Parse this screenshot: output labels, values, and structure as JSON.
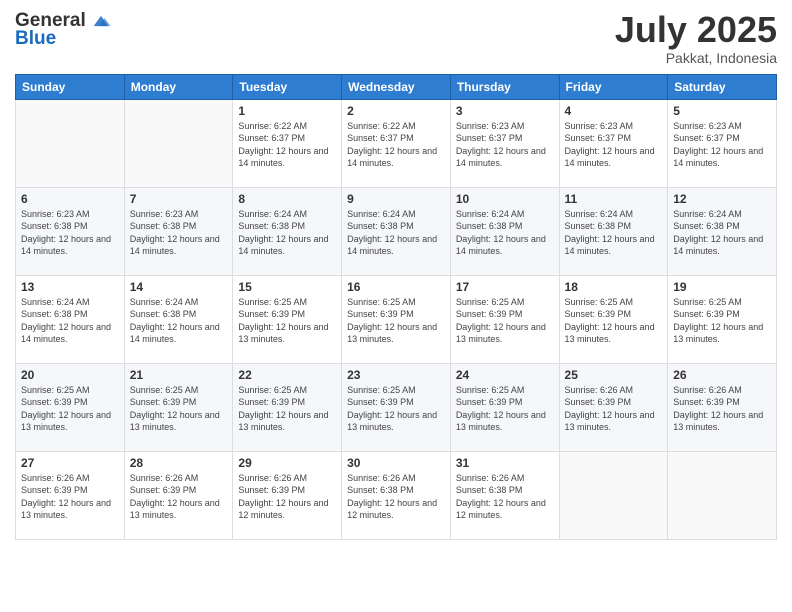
{
  "logo": {
    "text1": "General",
    "text2": "Blue"
  },
  "title": "July 2025",
  "location": "Pakkat, Indonesia",
  "weekdays": [
    "Sunday",
    "Monday",
    "Tuesday",
    "Wednesday",
    "Thursday",
    "Friday",
    "Saturday"
  ],
  "weeks": [
    [
      {
        "day": "",
        "info": ""
      },
      {
        "day": "",
        "info": ""
      },
      {
        "day": "1",
        "info": "Sunrise: 6:22 AM\nSunset: 6:37 PM\nDaylight: 12 hours and 14 minutes."
      },
      {
        "day": "2",
        "info": "Sunrise: 6:22 AM\nSunset: 6:37 PM\nDaylight: 12 hours and 14 minutes."
      },
      {
        "day": "3",
        "info": "Sunrise: 6:23 AM\nSunset: 6:37 PM\nDaylight: 12 hours and 14 minutes."
      },
      {
        "day": "4",
        "info": "Sunrise: 6:23 AM\nSunset: 6:37 PM\nDaylight: 12 hours and 14 minutes."
      },
      {
        "day": "5",
        "info": "Sunrise: 6:23 AM\nSunset: 6:37 PM\nDaylight: 12 hours and 14 minutes."
      }
    ],
    [
      {
        "day": "6",
        "info": "Sunrise: 6:23 AM\nSunset: 6:38 PM\nDaylight: 12 hours and 14 minutes."
      },
      {
        "day": "7",
        "info": "Sunrise: 6:23 AM\nSunset: 6:38 PM\nDaylight: 12 hours and 14 minutes."
      },
      {
        "day": "8",
        "info": "Sunrise: 6:24 AM\nSunset: 6:38 PM\nDaylight: 12 hours and 14 minutes."
      },
      {
        "day": "9",
        "info": "Sunrise: 6:24 AM\nSunset: 6:38 PM\nDaylight: 12 hours and 14 minutes."
      },
      {
        "day": "10",
        "info": "Sunrise: 6:24 AM\nSunset: 6:38 PM\nDaylight: 12 hours and 14 minutes."
      },
      {
        "day": "11",
        "info": "Sunrise: 6:24 AM\nSunset: 6:38 PM\nDaylight: 12 hours and 14 minutes."
      },
      {
        "day": "12",
        "info": "Sunrise: 6:24 AM\nSunset: 6:38 PM\nDaylight: 12 hours and 14 minutes."
      }
    ],
    [
      {
        "day": "13",
        "info": "Sunrise: 6:24 AM\nSunset: 6:38 PM\nDaylight: 12 hours and 14 minutes."
      },
      {
        "day": "14",
        "info": "Sunrise: 6:24 AM\nSunset: 6:38 PM\nDaylight: 12 hours and 14 minutes."
      },
      {
        "day": "15",
        "info": "Sunrise: 6:25 AM\nSunset: 6:39 PM\nDaylight: 12 hours and 13 minutes."
      },
      {
        "day": "16",
        "info": "Sunrise: 6:25 AM\nSunset: 6:39 PM\nDaylight: 12 hours and 13 minutes."
      },
      {
        "day": "17",
        "info": "Sunrise: 6:25 AM\nSunset: 6:39 PM\nDaylight: 12 hours and 13 minutes."
      },
      {
        "day": "18",
        "info": "Sunrise: 6:25 AM\nSunset: 6:39 PM\nDaylight: 12 hours and 13 minutes."
      },
      {
        "day": "19",
        "info": "Sunrise: 6:25 AM\nSunset: 6:39 PM\nDaylight: 12 hours and 13 minutes."
      }
    ],
    [
      {
        "day": "20",
        "info": "Sunrise: 6:25 AM\nSunset: 6:39 PM\nDaylight: 12 hours and 13 minutes."
      },
      {
        "day": "21",
        "info": "Sunrise: 6:25 AM\nSunset: 6:39 PM\nDaylight: 12 hours and 13 minutes."
      },
      {
        "day": "22",
        "info": "Sunrise: 6:25 AM\nSunset: 6:39 PM\nDaylight: 12 hours and 13 minutes."
      },
      {
        "day": "23",
        "info": "Sunrise: 6:25 AM\nSunset: 6:39 PM\nDaylight: 12 hours and 13 minutes."
      },
      {
        "day": "24",
        "info": "Sunrise: 6:25 AM\nSunset: 6:39 PM\nDaylight: 12 hours and 13 minutes."
      },
      {
        "day": "25",
        "info": "Sunrise: 6:26 AM\nSunset: 6:39 PM\nDaylight: 12 hours and 13 minutes."
      },
      {
        "day": "26",
        "info": "Sunrise: 6:26 AM\nSunset: 6:39 PM\nDaylight: 12 hours and 13 minutes."
      }
    ],
    [
      {
        "day": "27",
        "info": "Sunrise: 6:26 AM\nSunset: 6:39 PM\nDaylight: 12 hours and 13 minutes."
      },
      {
        "day": "28",
        "info": "Sunrise: 6:26 AM\nSunset: 6:39 PM\nDaylight: 12 hours and 13 minutes."
      },
      {
        "day": "29",
        "info": "Sunrise: 6:26 AM\nSunset: 6:39 PM\nDaylight: 12 hours and 12 minutes."
      },
      {
        "day": "30",
        "info": "Sunrise: 6:26 AM\nSunset: 6:38 PM\nDaylight: 12 hours and 12 minutes."
      },
      {
        "day": "31",
        "info": "Sunrise: 6:26 AM\nSunset: 6:38 PM\nDaylight: 12 hours and 12 minutes."
      },
      {
        "day": "",
        "info": ""
      },
      {
        "day": "",
        "info": ""
      }
    ]
  ]
}
